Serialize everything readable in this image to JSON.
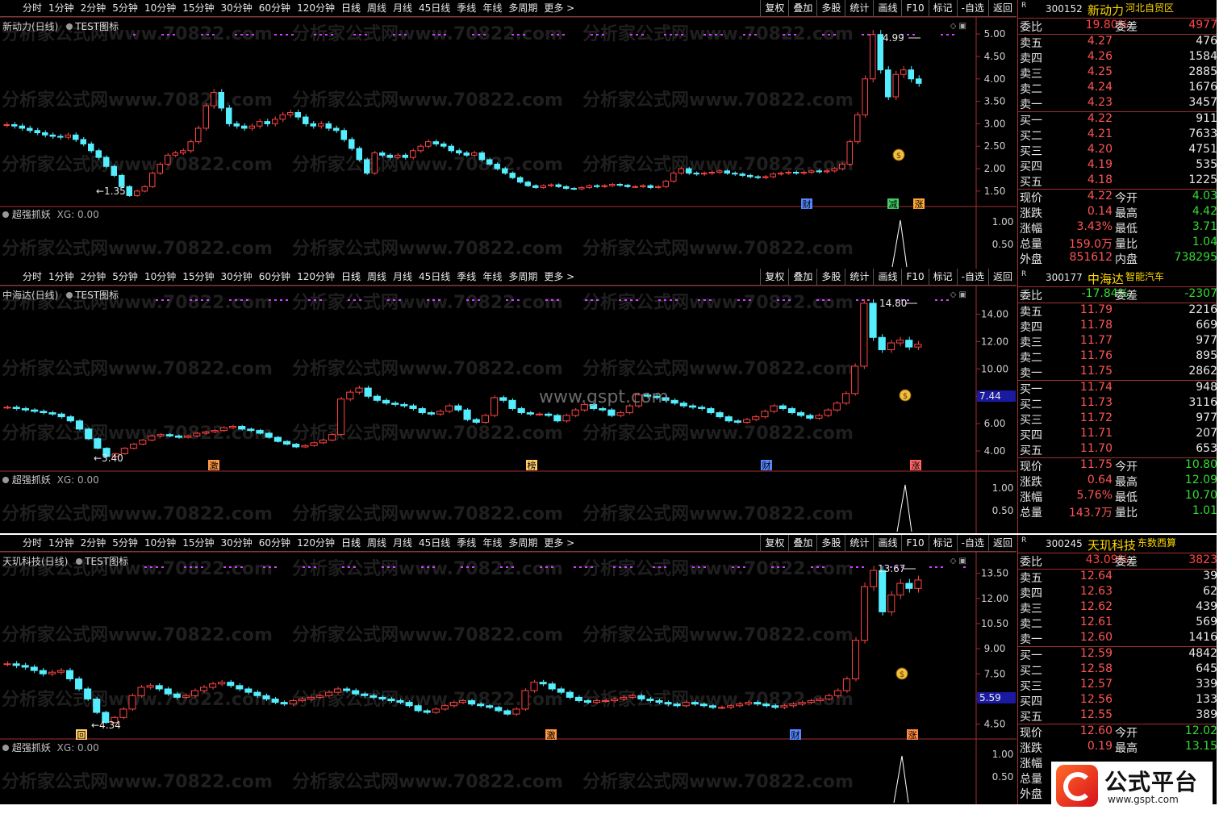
{
  "toolbar": {
    "periods": [
      "分时",
      "1分钟",
      "2分钟",
      "5分钟",
      "10分钟",
      "15分钟",
      "30分钟",
      "60分钟",
      "120分钟",
      "日线",
      "周线",
      "月线",
      "45日线",
      "季线",
      "年线",
      "多周期",
      "更多 >"
    ],
    "tools": [
      "复权",
      "叠加",
      "多股",
      "统计",
      "画线",
      "F10",
      "标记",
      "-自选",
      "返回"
    ]
  },
  "watermark_text": "分析家公式网www.70822.com",
  "center_watermark": "www.gspt.com",
  "logo": {
    "text": "公式平台",
    "url": "www.gspt.com"
  },
  "colors": {
    "up": "#ff4444",
    "down": "#55eeff",
    "accent": "#ffd800",
    "frame": "#a03030"
  },
  "panels": [
    {
      "title": "新动力(日线)",
      "indicator": "TEST图标",
      "sub_title": "超强抓妖",
      "sub_value": "XG: 0.00",
      "y_ticks": [
        "5.00",
        "4.50",
        "4.00",
        "3.50",
        "3.00",
        "2.50",
        "2.00",
        "1.50"
      ],
      "sub_ticks": [
        "1.00",
        "0.50"
      ],
      "high_label": "4.99",
      "low_label": "1.35",
      "badges": [
        {
          "text": "财"
        },
        {
          "text": "减"
        },
        {
          "text": "涨"
        }
      ],
      "quote": {
        "code": "300152",
        "name": "新动力",
        "tag": "河北自贸区",
        "wb": "19.80%",
        "wc": "4977",
        "asks": [
          [
            "卖五",
            "4.27",
            "476"
          ],
          [
            "卖四",
            "4.26",
            "1584"
          ],
          [
            "卖三",
            "4.25",
            "2885"
          ],
          [
            "卖二",
            "4.24",
            "1676"
          ],
          [
            "卖一",
            "4.23",
            "3457"
          ]
        ],
        "bids": [
          [
            "买一",
            "4.22",
            "911"
          ],
          [
            "买二",
            "4.21",
            "7633"
          ],
          [
            "买三",
            "4.20",
            "4751"
          ],
          [
            "买四",
            "4.19",
            "535"
          ],
          [
            "买五",
            "4.18",
            "1225"
          ]
        ],
        "stats": [
          [
            "现价",
            "4.22",
            "今开",
            "4.03"
          ],
          [
            "涨跌",
            "0.14",
            "最高",
            "4.42"
          ],
          [
            "涨幅",
            "3.43%",
            "最低",
            "3.71"
          ],
          [
            "总量",
            "159.0万",
            "量比",
            "1.04"
          ],
          [
            "外盘",
            "851612",
            "内盘",
            "738295"
          ]
        ]
      }
    },
    {
      "title": "中海达(日线)",
      "indicator": "TEST图标",
      "sub_title": "超强抓妖",
      "sub_value": "XG: 0.00",
      "y_ticks": [
        "14.00",
        "12.00",
        "10.00",
        "8.00",
        "6.00",
        "4.00"
      ],
      "sub_ticks": [
        "1.00",
        "0.50"
      ],
      "high_label": "14.80",
      "low_label": "3.40",
      "price_tag": "7.44",
      "badges": [
        {
          "text": "激"
        },
        {
          "text": "榜"
        },
        {
          "text": "财"
        },
        {
          "text": "涨"
        }
      ],
      "quote": {
        "code": "300177",
        "name": "中海达",
        "tag": "智能汽车",
        "wb": "-17.84%",
        "wc": "-2307",
        "asks": [
          [
            "卖五",
            "11.79",
            "2216"
          ],
          [
            "卖四",
            "11.78",
            "669"
          ],
          [
            "卖三",
            "11.77",
            "977"
          ],
          [
            "卖二",
            "11.76",
            "895"
          ],
          [
            "卖一",
            "11.75",
            "2862"
          ]
        ],
        "bids": [
          [
            "买一",
            "11.74",
            "948"
          ],
          [
            "买二",
            "11.73",
            "3116"
          ],
          [
            "买三",
            "11.72",
            "977"
          ],
          [
            "买四",
            "11.71",
            "207"
          ],
          [
            "买五",
            "11.70",
            "653"
          ]
        ],
        "stats": [
          [
            "现价",
            "11.75",
            "今开",
            "10.80"
          ],
          [
            "涨跌",
            "0.64",
            "最高",
            "12.09"
          ],
          [
            "涨幅",
            "5.76%",
            "最低",
            "10.70"
          ],
          [
            "总量",
            "143.7万",
            "量比",
            "1.01"
          ]
        ]
      }
    },
    {
      "title": "天玑科技(日线)",
      "indicator": "TEST图标",
      "sub_title": "超强抓妖",
      "sub_value": "XG: 0.00",
      "y_ticks": [
        "13.50",
        "12.00",
        "10.50",
        "9.00",
        "7.50",
        "6.00",
        "4.50"
      ],
      "sub_ticks": [
        "1.00",
        "0.50"
      ],
      "high_label": "13.67",
      "low_label": "4.34",
      "price_tag": "5.59",
      "badges": [
        {
          "text": "回"
        },
        {
          "text": "激"
        },
        {
          "text": "财"
        },
        {
          "text": "涨"
        }
      ],
      "quote": {
        "code": "300245",
        "name": "天玑科技",
        "tag": "东数西算",
        "wb": "43.09%",
        "wc": "3823",
        "asks": [
          [
            "卖五",
            "12.64",
            "39"
          ],
          [
            "卖四",
            "12.63",
            "62"
          ],
          [
            "卖三",
            "12.62",
            "439"
          ],
          [
            "卖二",
            "12.61",
            "569"
          ],
          [
            "卖一",
            "12.60",
            "1416"
          ]
        ],
        "bids": [
          [
            "买一",
            "12.59",
            "4842"
          ],
          [
            "买二",
            "12.58",
            "645"
          ],
          [
            "买三",
            "12.57",
            "339"
          ],
          [
            "买四",
            "12.56",
            "133"
          ],
          [
            "买五",
            "12.55",
            "389"
          ]
        ],
        "stats": [
          [
            "现价",
            "12.60",
            "今开",
            "12.02"
          ],
          [
            "涨跌",
            "0.19",
            "最高",
            "13.15"
          ],
          [
            "涨幅",
            "",
            "",
            ""
          ],
          [
            "总量",
            "",
            "",
            ""
          ],
          [
            "外盘",
            "",
            "",
            ""
          ]
        ]
      }
    }
  ]
}
